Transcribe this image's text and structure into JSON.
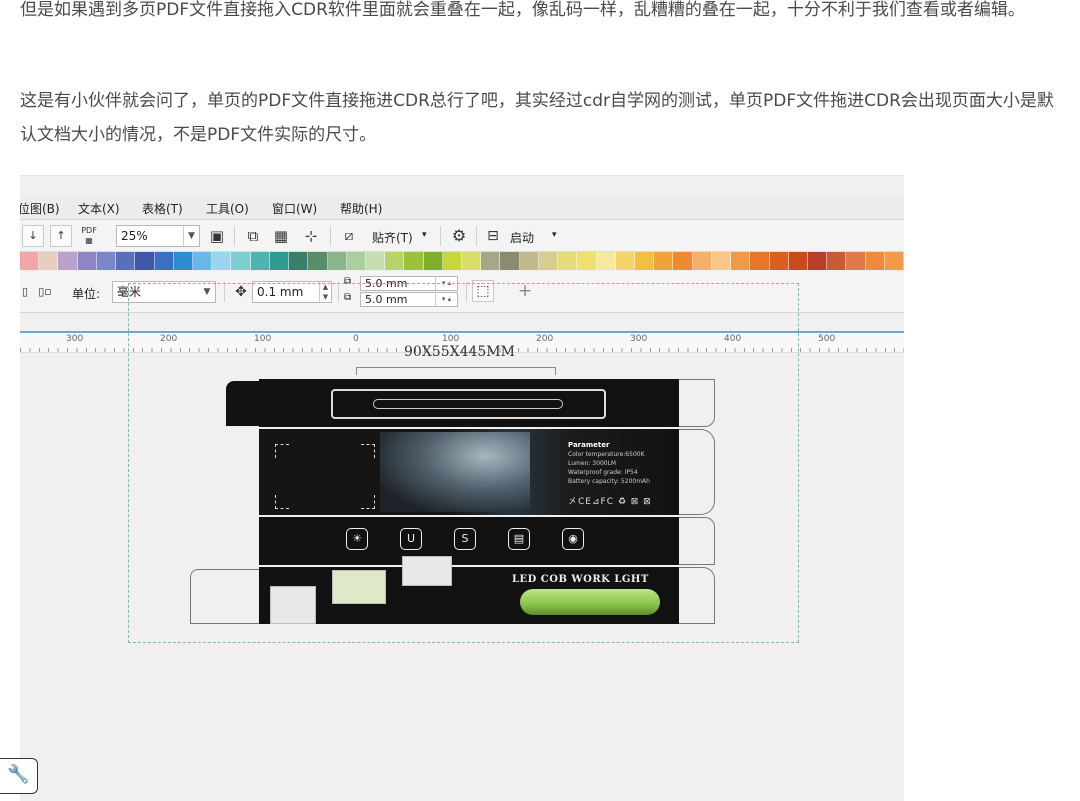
{
  "article": {
    "paragraph_1": "但是如果遇到多页PDF文件直接拖入CDR软件里面就会重叠在一起，像乱码一样，乱糟糟的叠在一起，十分不利于我们查看或者编辑。",
    "paragraph_2": "这是有小伙伴就会问了，单页的PDF文件直接拖进CDR总行了吧，其实经过cdr自学网的测试，单页PDF文件拖进CDR会出现页面大小是默认文档大小的情况，不是PDF文件实际的尺寸。"
  },
  "screenshot": {
    "menu": [
      "位图(B)",
      "文本(X)",
      "表格(T)",
      "工具(O)",
      "窗口(W)",
      "帮助(H)"
    ],
    "toolbar": {
      "pdf_label": "PDF",
      "zoom": "25%",
      "snap_label": "贴齐(T)",
      "launch_label": "启动"
    },
    "palette_colors": [
      "#f2a6a6",
      "#e7cfc0",
      "#b9a2c9",
      "#8e86c2",
      "#7b87c7",
      "#5b6fb8",
      "#3f57a6",
      "#3a6fc1",
      "#2e8bd0",
      "#6ab8e6",
      "#9bd4ef",
      "#7fcfd0",
      "#4fb3b0",
      "#2f9a8f",
      "#3d7d6b",
      "#5b8c6a",
      "#8ab58a",
      "#a9cfa0",
      "#c6ddb0",
      "#b9d36b",
      "#9cc23c",
      "#7fae2a",
      "#c6d63d",
      "#d9dd6a",
      "#a8a58a",
      "#8d8b6f",
      "#c3b98c",
      "#d8cc93",
      "#e6dc7a",
      "#f0e070",
      "#f5e9a0",
      "#f4d36a",
      "#f2c040",
      "#f0a33a",
      "#ef8a2e",
      "#f2b06a",
      "#f6c98a",
      "#ee9a4a",
      "#e6762a",
      "#d95f20",
      "#c94a1a",
      "#b8402a",
      "#c85a3a",
      "#e07a4a",
      "#f08a3a",
      "#f29a4a"
    ],
    "property_bar": {
      "unit_label": "单位:",
      "unit_value": "毫米",
      "nudge": "0.1 mm",
      "dup_x": "5.0 mm",
      "dup_y": "5.0 mm"
    },
    "ruler_labels": [
      "300",
      "200",
      "100",
      "0",
      "100",
      "200",
      "300",
      "400",
      "500"
    ],
    "canvas": {
      "dimension_label": "90X55X445MM",
      "params_title": "Parameter",
      "params_lines": [
        "Color temperature:6500K",
        "Lumen: 3000LM",
        "Waterproof grade: IP54",
        "Battery capacity: 5200mAh"
      ],
      "certs": "㐅CE⊿FC ♻ ⊠ ⊠",
      "product_title": "LED COB WORK LGHT"
    }
  }
}
